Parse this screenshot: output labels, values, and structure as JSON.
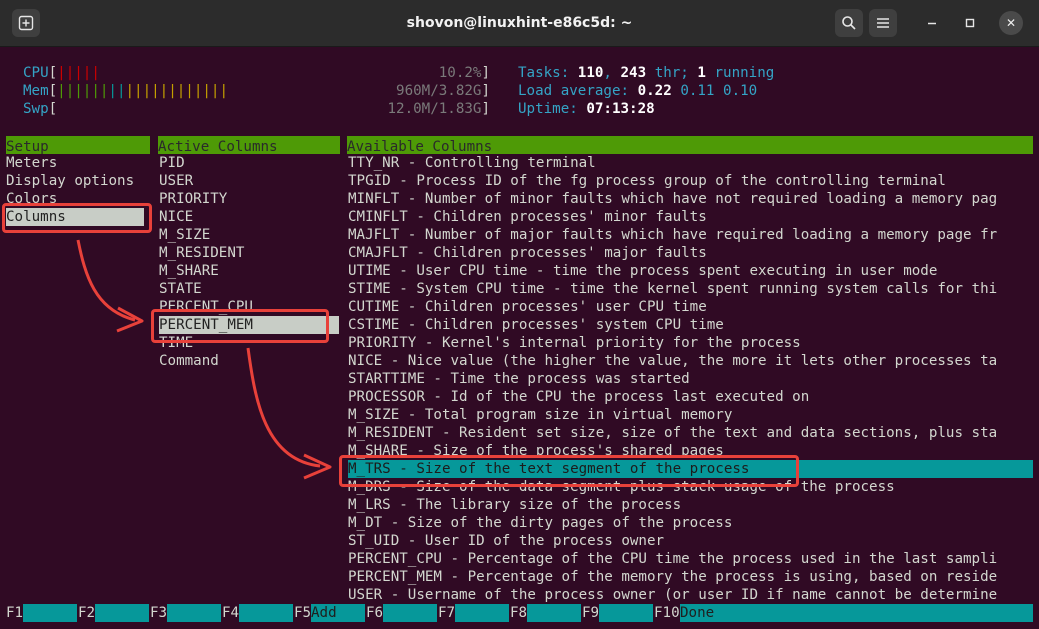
{
  "window": {
    "title": "shovon@linuxhint-e86c5d: ~"
  },
  "meters": {
    "cpu": {
      "label": "CPU",
      "bars": "|||||",
      "value": "10.2%"
    },
    "mem": {
      "label": "Mem",
      "bars_green": "||||||",
      "bars_blue": "||",
      "bars_yellow": "||||||||||||",
      "value": "960M/3.82G"
    },
    "swp": {
      "label": "Swp",
      "value": "12.0M/1.83G"
    },
    "tasks_label": "Tasks:",
    "tasks_count": "110",
    "tasks_thr": "243",
    "tasks_thr_label": "thr;",
    "tasks_running": "1",
    "tasks_running_label": "running",
    "load_label": "Load average:",
    "load1": "0.22",
    "load5": "0.11",
    "load15": "0.10",
    "uptime_label": "Uptime:",
    "uptime": "07:13:28"
  },
  "setup": {
    "header": "Setup",
    "items": [
      "Meters",
      "Display options",
      "Colors",
      "Columns"
    ]
  },
  "active_columns": {
    "header": "Active Columns",
    "items": [
      "PID",
      "USER",
      "PRIORITY",
      "NICE",
      "M_SIZE",
      "M_RESIDENT",
      "M_SHARE",
      "STATE",
      "PERCENT_CPU",
      "PERCENT_MEM",
      "TIME",
      "Command"
    ]
  },
  "available_columns": {
    "header": "Available Columns",
    "items": [
      "TTY_NR - Controlling terminal",
      "TPGID - Process ID of the fg process group of the controlling terminal",
      "MINFLT - Number of minor faults which have not required loading a memory pag",
      "CMINFLT - Children processes' minor faults",
      "MAJFLT - Number of major faults which have required loading a memory page fr",
      "CMAJFLT - Children processes' major faults",
      "UTIME - User CPU time - time the process spent executing in user mode",
      "STIME - System CPU time - time the kernel spent running system calls for thi",
      "CUTIME - Children processes' user CPU time",
      "CSTIME - Children processes' system CPU time",
      "PRIORITY - Kernel's internal priority for the process",
      "NICE - Nice value (the higher the value, the more it lets other processes ta",
      "STARTTIME - Time the process was started",
      "PROCESSOR - Id of the CPU the process last executed on",
      "M_SIZE - Total program size in virtual memory",
      "M_RESIDENT - Resident set size, size of the text and data sections, plus sta",
      "M_SHARE - Size of the process's shared pages",
      "M_TRS - Size of the text segment of the process",
      "M_DRS - Size of the data segment plus stack usage of the process",
      "M_LRS - The library size of the process",
      "M_DT - Size of the dirty pages of the process",
      "ST_UID - User ID of the process owner",
      "PERCENT_CPU - Percentage of the CPU time the process used in the last sampli",
      "PERCENT_MEM - Percentage of the memory the process is using, based on reside",
      "USER - Username of the process owner (or user ID if name cannot be determine"
    ]
  },
  "fkeys": [
    {
      "key": "F1",
      "label": ""
    },
    {
      "key": "F2",
      "label": ""
    },
    {
      "key": "F3",
      "label": ""
    },
    {
      "key": "F4",
      "label": ""
    },
    {
      "key": "F5",
      "label": "Add"
    },
    {
      "key": "F6",
      "label": ""
    },
    {
      "key": "F7",
      "label": ""
    },
    {
      "key": "F8",
      "label": ""
    },
    {
      "key": "F9",
      "label": ""
    },
    {
      "key": "F10",
      "label": "Done"
    }
  ],
  "colors": {
    "terminal_bg": "#300a24",
    "header_green": "#4e9a06",
    "highlight_cyan": "#06989a",
    "annotation_red": "#e8413a"
  }
}
